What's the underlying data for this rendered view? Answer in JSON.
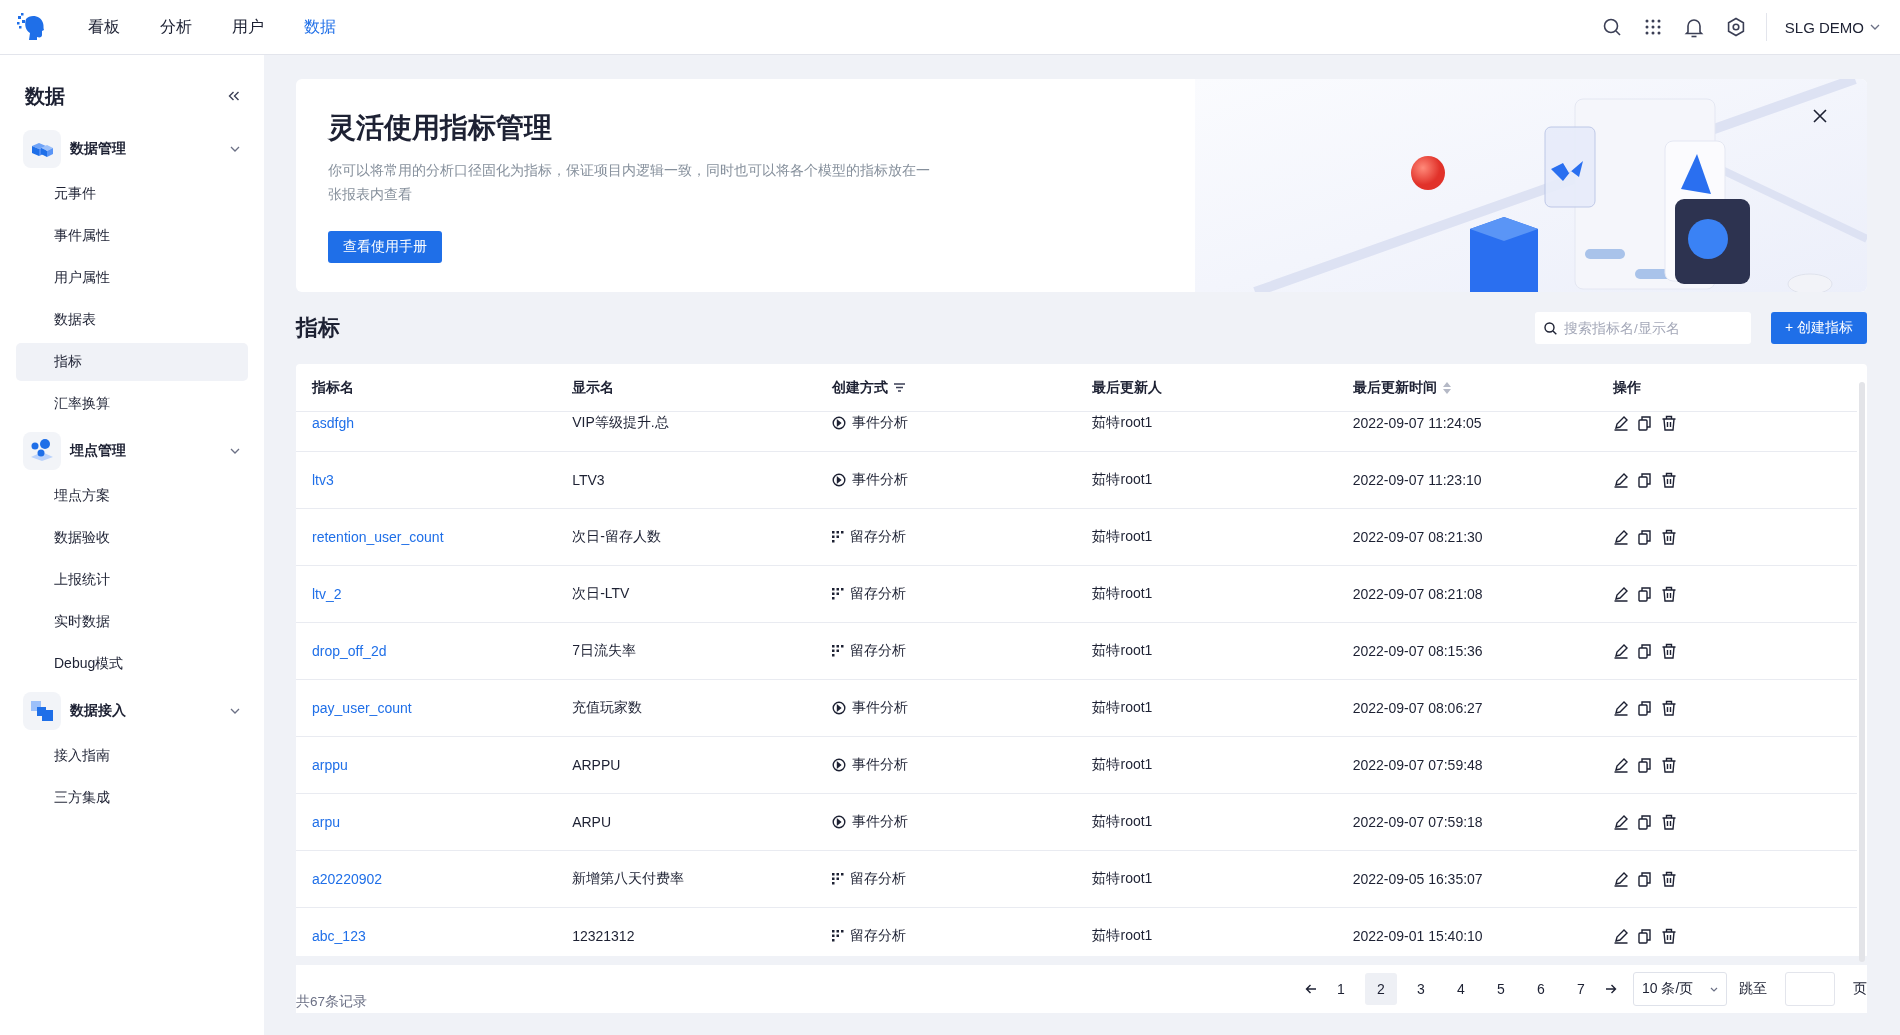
{
  "top_nav": {
    "tabs": [
      {
        "label": "看板",
        "selected": false
      },
      {
        "label": "分析",
        "selected": false
      },
      {
        "label": "用户",
        "selected": false
      },
      {
        "label": "数据",
        "selected": true
      }
    ],
    "workspace": "SLG DEMO"
  },
  "sidebar": {
    "title": "数据",
    "groups": [
      {
        "label": "数据管理",
        "expanded": true,
        "items": [
          {
            "label": "元事件",
            "selected": false
          },
          {
            "label": "事件属性",
            "selected": false
          },
          {
            "label": "用户属性",
            "selected": false
          },
          {
            "label": "数据表",
            "selected": false
          },
          {
            "label": "指标",
            "selected": true
          },
          {
            "label": "汇率换算",
            "selected": false
          }
        ]
      },
      {
        "label": "埋点管理",
        "expanded": true,
        "items": [
          {
            "label": "埋点方案",
            "selected": false
          },
          {
            "label": "数据验收",
            "selected": false
          },
          {
            "label": "上报统计",
            "selected": false
          },
          {
            "label": "实时数据",
            "selected": false
          },
          {
            "label": "Debug模式",
            "selected": false
          }
        ]
      },
      {
        "label": "数据接入",
        "expanded": true,
        "items": [
          {
            "label": "接入指南",
            "selected": false
          },
          {
            "label": "三方集成",
            "selected": false
          }
        ]
      }
    ]
  },
  "banner": {
    "title": "灵活使用指标管理",
    "description": "你可以将常用的分析口径固化为指标，保证项目内逻辑一致，同时也可以将各个模型的指标放在一张报表内查看",
    "button": "查看使用手册"
  },
  "section": {
    "title": "指标",
    "search": {
      "placeholder": "搜索指标名/显示名"
    },
    "create_button": "+ 创建指标"
  },
  "table": {
    "columns": [
      {
        "label": "指标名",
        "filter": false,
        "sort": false
      },
      {
        "label": "显示名",
        "filter": false,
        "sort": false
      },
      {
        "label": "创建方式",
        "filter": true,
        "sort": false
      },
      {
        "label": "最后更新人",
        "filter": false,
        "sort": false
      },
      {
        "label": "最后更新时间",
        "filter": false,
        "sort": true
      },
      {
        "label": "操作",
        "filter": false,
        "sort": false
      }
    ],
    "rows": [
      {
        "name": "asdfgh",
        "display": "VIP等级提升.总",
        "method": {
          "kind": "event",
          "label": "事件分析"
        },
        "updater": "茹特root1",
        "updated": "2022-09-07 11:24:05"
      },
      {
        "name": "ltv3",
        "display": "LTV3",
        "method": {
          "kind": "event",
          "label": "事件分析"
        },
        "updater": "茹特root1",
        "updated": "2022-09-07 11:23:10"
      },
      {
        "name": "retention_user_count",
        "display": "次日-留存人数",
        "method": {
          "kind": "retention",
          "label": "留存分析"
        },
        "updater": "茹特root1",
        "updated": "2022-09-07 08:21:30"
      },
      {
        "name": "ltv_2",
        "display": "次日-LTV",
        "method": {
          "kind": "retention",
          "label": "留存分析"
        },
        "updater": "茹特root1",
        "updated": "2022-09-07 08:21:08"
      },
      {
        "name": "drop_off_2d",
        "display": "7日流失率",
        "method": {
          "kind": "retention",
          "label": "留存分析"
        },
        "updater": "茹特root1",
        "updated": "2022-09-07 08:15:36"
      },
      {
        "name": "pay_user_count",
        "display": "充值玩家数",
        "method": {
          "kind": "event",
          "label": "事件分析"
        },
        "updater": "茹特root1",
        "updated": "2022-09-07 08:06:27"
      },
      {
        "name": "arppu",
        "display": "ARPPU",
        "method": {
          "kind": "event",
          "label": "事件分析"
        },
        "updater": "茹特root1",
        "updated": "2022-09-07 07:59:48"
      },
      {
        "name": "arpu",
        "display": "ARPU",
        "method": {
          "kind": "event",
          "label": "事件分析"
        },
        "updater": "茹特root1",
        "updated": "2022-09-07 07:59:18"
      },
      {
        "name": "a20220902",
        "display": "新增第八天付费率",
        "method": {
          "kind": "retention",
          "label": "留存分析"
        },
        "updater": "茹特root1",
        "updated": "2022-09-05 16:35:07"
      },
      {
        "name": "abc_123",
        "display": "12321312",
        "method": {
          "kind": "retention",
          "label": "留存分析"
        },
        "updater": "茹特root1",
        "updated": "2022-09-01 15:40:10"
      }
    ]
  },
  "pagination": {
    "total": "共67条记录",
    "pages": [
      {
        "label": "1",
        "selected": false
      },
      {
        "label": "2",
        "selected": true
      },
      {
        "label": "3",
        "selected": false
      },
      {
        "label": "4",
        "selected": false
      },
      {
        "label": "5",
        "selected": false
      },
      {
        "label": "6",
        "selected": false
      },
      {
        "label": "7",
        "selected": false
      }
    ],
    "page_size": "10 条/页",
    "jump_label": "跳至",
    "jump_suffix": "页"
  }
}
